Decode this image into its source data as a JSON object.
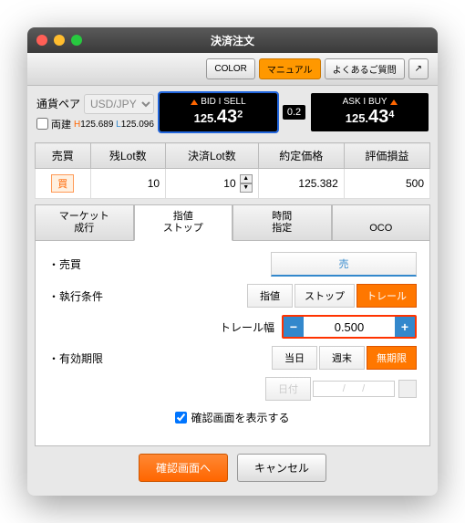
{
  "title": "決済注文",
  "toolbar": {
    "color": "COLOR",
    "manual": "マニュアル",
    "faq": "よくあるご質問"
  },
  "pair": {
    "label": "通貨ペア",
    "value": "USD/JPY",
    "high": "125.689",
    "low": "125.096",
    "ryodate": "両建"
  },
  "bid": {
    "label": "BID I SELL",
    "big": "125.",
    "mid": "43",
    "sm": "2"
  },
  "ask": {
    "label": "ASK I BUY",
    "big": "125.",
    "mid": "43",
    "sm": "4"
  },
  "spread": "0.2",
  "cols": {
    "c1": "売買",
    "c2": "残Lot数",
    "c3": "決済Lot数",
    "c4": "約定価格",
    "c5": "評価損益"
  },
  "row": {
    "side": "買",
    "remain": "10",
    "settle": "10",
    "price": "125.382",
    "pl": "500"
  },
  "tabs": {
    "t1a": "マーケット",
    "t1b": "成行",
    "t2a": "指値",
    "t2b": "ストップ",
    "t3a": "時間",
    "t3b": "指定",
    "t4": "OCO"
  },
  "form": {
    "side": "売買",
    "sell": "売",
    "exec": "執行条件",
    "limit": "指値",
    "stop": "ストップ",
    "trail": "トレール",
    "trailw": "トレール幅",
    "trailv": "0.500",
    "expiry": "有効期限",
    "today": "当日",
    "weekend": "週末",
    "nolimit": "無期限",
    "date": "日付",
    "dateval": "/      /"
  },
  "confirm": "確認画面を表示する",
  "go": "確認画面へ",
  "cancel": "キャンセル"
}
